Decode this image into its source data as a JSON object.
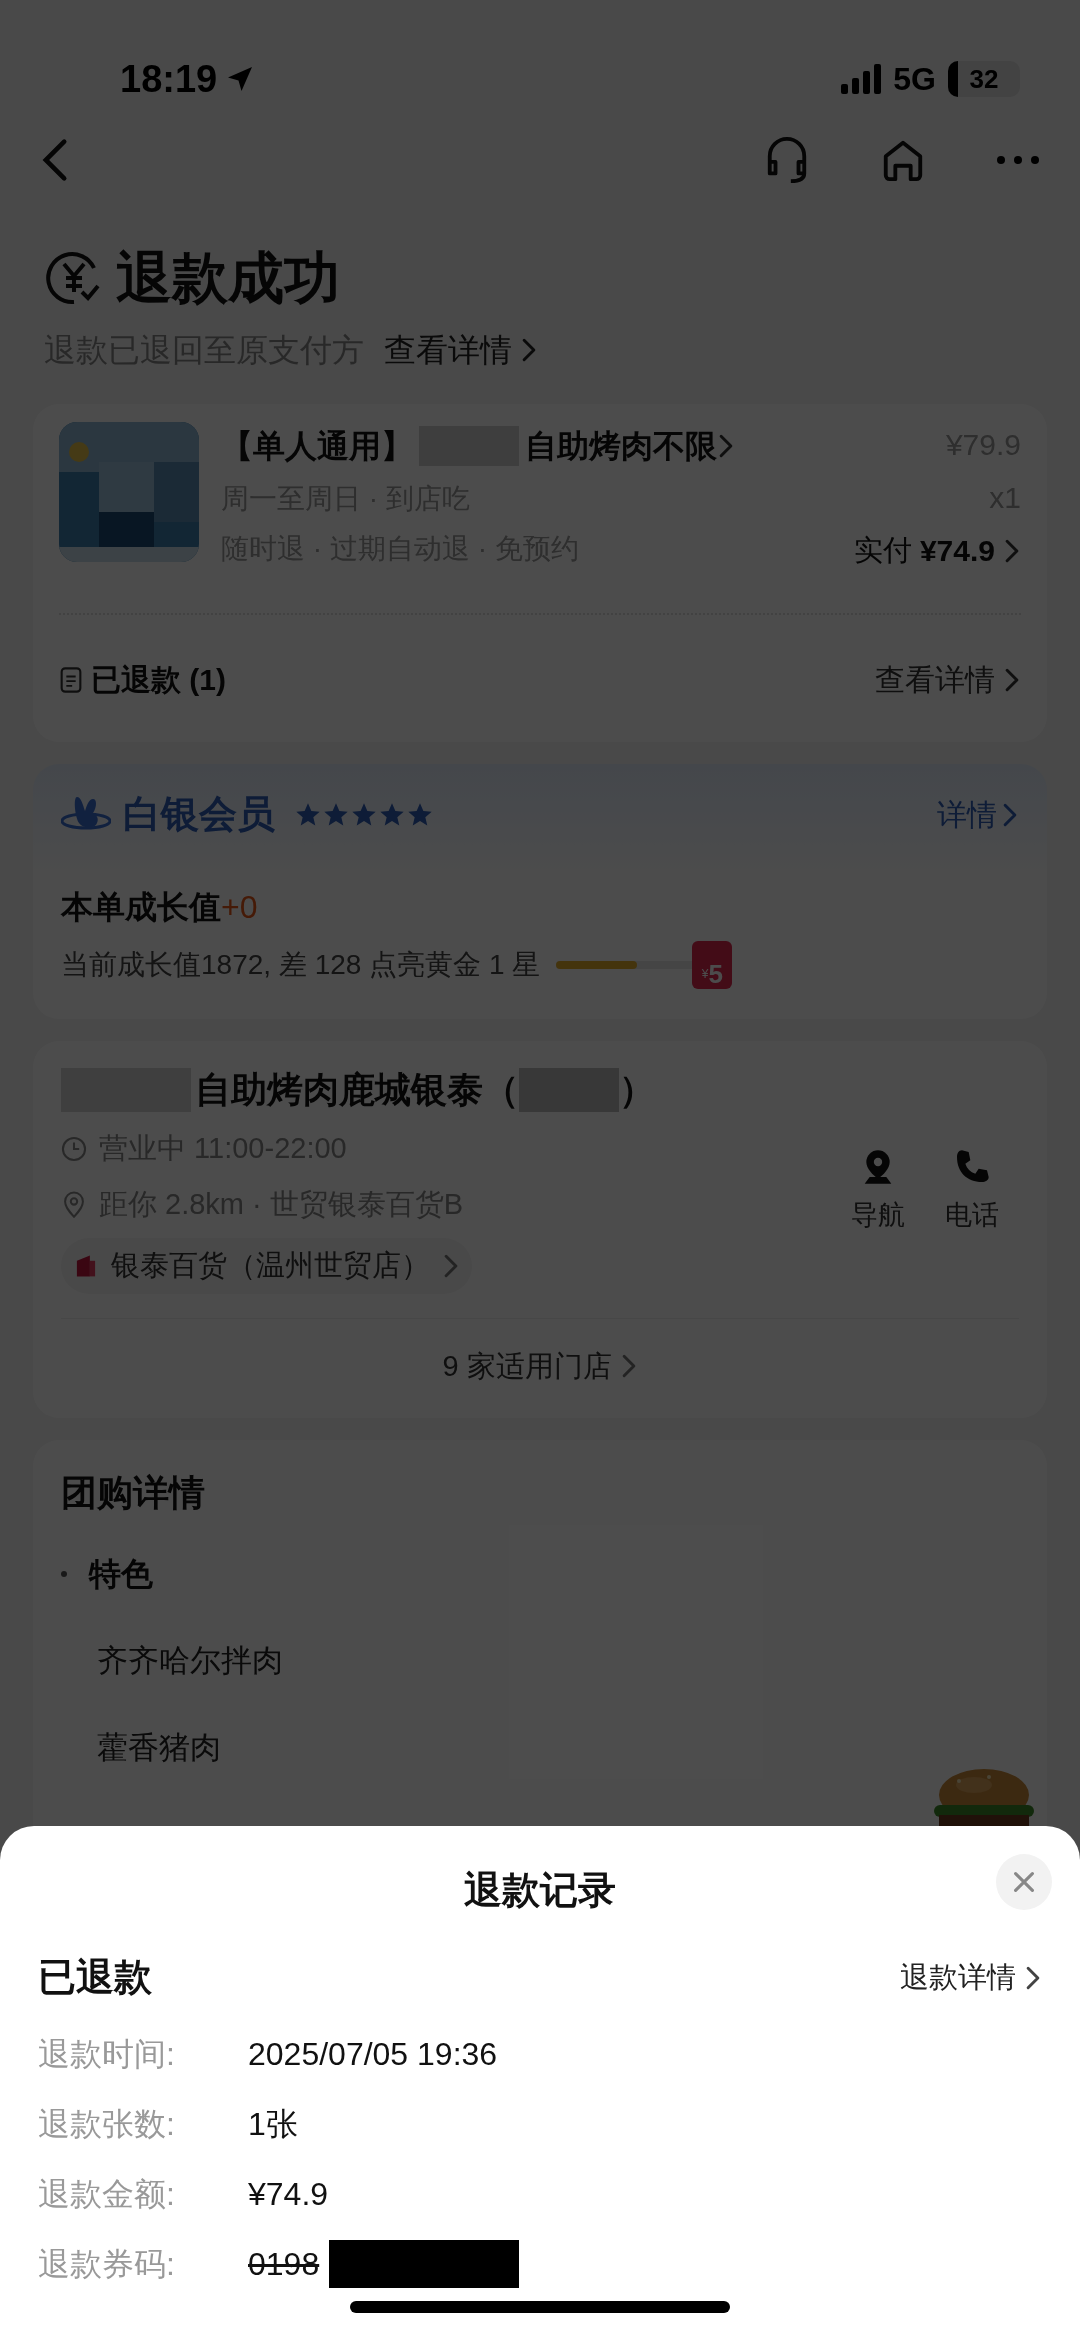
{
  "status_bar": {
    "time": "18:19",
    "network": "5G",
    "battery": "32"
  },
  "header": {
    "title": "退款成功",
    "subtitle": "退款已退回至原支付方",
    "link": "查看详情"
  },
  "order": {
    "title_prefix": "【单人通用】",
    "title_suffix": "自助烤肉不限",
    "schedule": "周一至周日 · 到店吃",
    "terms": "随时退 · 过期自动退 · 免预约",
    "original_price": "¥79.9",
    "quantity": "x1",
    "paid_label": "实付",
    "paid_amount": "¥74.9",
    "refund_status": "已退款 (1)",
    "details_link": "查看详情"
  },
  "member": {
    "tier": "白银会员",
    "stars": 5,
    "details_link": "详情",
    "growth_label": "本单成长值",
    "growth_value": "+0",
    "progress_text": "当前成长值1872, 差 128 点亮黄金 1 星",
    "level": 0.58,
    "reward": "5",
    "reward_currency": "¥"
  },
  "store": {
    "name": "自助烤肉鹿城银泰（",
    "name_end": "）",
    "hours": "营业中 11:00-22:00",
    "distance": "距你 2.8km ·  世贸银泰百货B",
    "mall": "银泰百货（温州世贸店）",
    "nav_label": "导航",
    "call_label": "电话",
    "stores_link": "9 家适用门店"
  },
  "deal": {
    "title": "团购详情",
    "section": "特色",
    "items": [
      "齐齐哈尔拌肉",
      "藿香猪肉"
    ]
  },
  "sheet": {
    "title": "退款记录",
    "status": "已退款",
    "details_link": "退款详情",
    "rows": [
      {
        "label": "退款时间:",
        "value": "2025/07/05 19:36",
        "struck": false
      },
      {
        "label": "退款张数:",
        "value": "1张",
        "struck": false
      },
      {
        "label": "退款金额:",
        "value": "¥74.9",
        "struck": false
      },
      {
        "label": "退款券码:",
        "value": "0198",
        "struck": true
      }
    ]
  }
}
